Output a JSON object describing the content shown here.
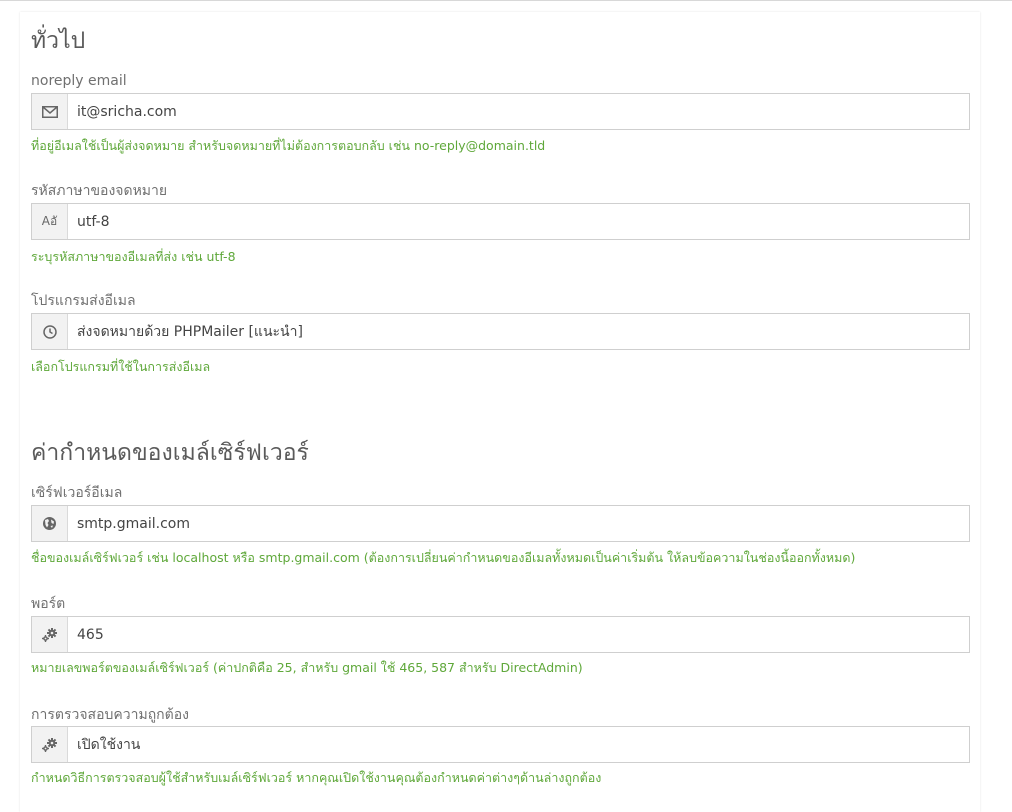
{
  "general": {
    "title": "ทั่วไป",
    "noreply": {
      "label": "noreply email",
      "value": "it@sricha.com",
      "help": "ที่อยู่อีเมลใช้เป็นผู้ส่งจดหมาย สำหรับจดหมายที่ไม่ต้องการตอบกลับ เช่น no-reply@domain.tld",
      "icon": "envelope-icon"
    },
    "charset": {
      "label": "รหัสภาษาของจดหมาย",
      "value": "utf-8",
      "help": "ระบุรหัสภาษาของอีเมลที่ส่ง เช่น utf-8",
      "icon": "language-icon",
      "icon_text": "Aอั"
    },
    "mailer": {
      "label": "โปรแกรมส่งอีเมล",
      "value": "ส่งจดหมายด้วย PHPMailer [แนะนำ]",
      "help": "เลือกโปรแกรมที่ใช้ในการส่งอีเมล",
      "icon": "clock-icon"
    }
  },
  "server": {
    "title": "ค่ากำหนดของเมล์เซิร์ฟเวอร์",
    "host": {
      "label": "เซิร์ฟเวอร์อีเมล",
      "value": "smtp.gmail.com",
      "help": "ชื่อของเมล์เซิร์ฟเวอร์ เช่น localhost หรือ smtp.gmail.com (ต้องการเปลี่ยนค่ากำหนดของอีเมลทั้งหมดเป็นค่าเริ่มต้น ให้ลบข้อความในช่องนี้ออกทั้งหมด)",
      "icon": "globe-icon"
    },
    "port": {
      "label": "พอร์ต",
      "value": "465",
      "help": "หมายเลขพอร์ตของเมล์เซิร์ฟเวอร์ (ค่าปกติคือ 25, สำหรับ gmail ใช้ 465, 587 สำหรับ DirectAdmin)",
      "icon": "gears-icon"
    },
    "auth": {
      "label": "การตรวจสอบความถูกต้อง",
      "value": "เปิดใช้งาน",
      "help": "กำหนดวิธีการตรวจสอบผู้ใช้สำหรับเมล์เซิร์ฟเวอร์ หากคุณเปิดใช้งานคุณต้องกำหนดค่าต่างๆด้านล่างถูกต้อง",
      "icon": "gears-icon"
    }
  },
  "colors": {
    "help_text": "#5fa83a",
    "addon_bg": "#f2f2f2",
    "border": "#cfcfcf"
  }
}
